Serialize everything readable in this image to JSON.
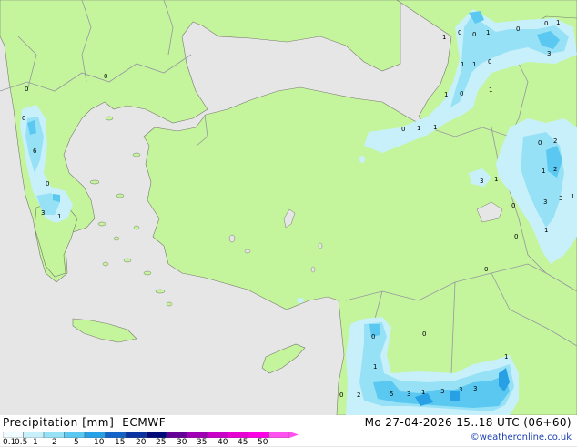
{
  "title": "Precipitation [mm]",
  "model": "ECMWF",
  "valid_time": "Mo 27-04-2026 15..18 UTC (06+60)",
  "credit": "©weatheronline.co.uk",
  "scale": {
    "labels": [
      "0.1",
      "0.5",
      "1",
      "2",
      "5",
      "10",
      "15",
      "20",
      "25",
      "30",
      "35",
      "40",
      "45",
      "50"
    ],
    "colors": [
      "#f0fcff",
      "#c8f0fa",
      "#96e1f5",
      "#5ac8f0",
      "#28a0e6",
      "#1464c8",
      "#0a32a0",
      "#000a78",
      "#640096",
      "#a000b4",
      "#c800c8",
      "#e600d2",
      "#ff00e6",
      "#ff50f0"
    ]
  },
  "map_colors": {
    "land": "#c4f59c",
    "sea": "#e6e6e6",
    "border": "#9696a0",
    "coast": "#78786e"
  },
  "map_values": [
    {
      "v": "0"
    },
    {
      "v": "0"
    },
    {
      "v": "1"
    },
    {
      "v": "0"
    },
    {
      "v": "0"
    },
    {
      "v": "0"
    },
    {
      "v": "1"
    },
    {
      "v": "1"
    },
    {
      "v": "0"
    },
    {
      "v": "3"
    },
    {
      "v": "1"
    },
    {
      "v": "0"
    },
    {
      "v": "1"
    },
    {
      "v": "0"
    },
    {
      "v": "1"
    },
    {
      "v": "1"
    },
    {
      "v": "1"
    },
    {
      "v": "0"
    },
    {
      "v": "1"
    },
    {
      "v": "2"
    },
    {
      "v": "0"
    },
    {
      "v": "3"
    },
    {
      "v": "1"
    },
    {
      "v": "2"
    },
    {
      "v": "1"
    },
    {
      "v": "3"
    },
    {
      "v": "0"
    },
    {
      "v": "3"
    },
    {
      "v": "1"
    },
    {
      "v": "0"
    },
    {
      "v": "6"
    },
    {
      "v": "1"
    },
    {
      "v": "0"
    },
    {
      "v": "0"
    },
    {
      "v": "0"
    },
    {
      "v": "0"
    },
    {
      "v": "3"
    },
    {
      "v": "0"
    },
    {
      "v": "1"
    },
    {
      "v": "0"
    },
    {
      "v": "2"
    },
    {
      "v": "5"
    },
    {
      "v": "3"
    },
    {
      "v": "1"
    },
    {
      "v": "3"
    },
    {
      "v": "3"
    },
    {
      "v": "3"
    },
    {
      "v": "1"
    },
    {
      "v": "1"
    }
  ]
}
